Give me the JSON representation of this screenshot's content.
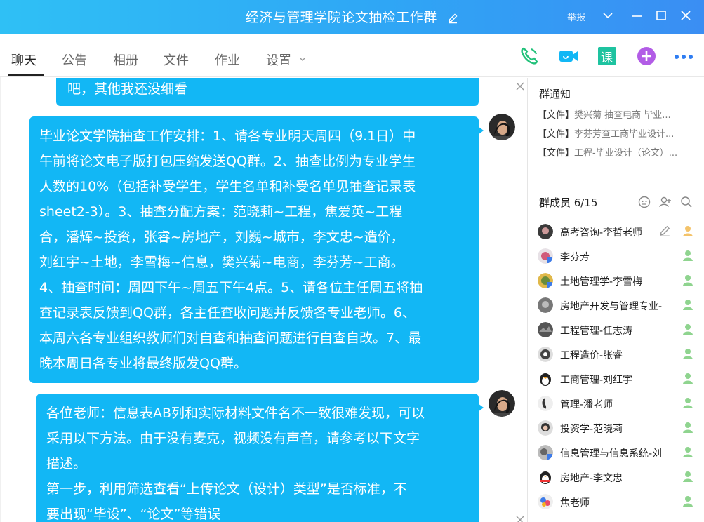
{
  "window": {
    "title": "经济与管理学院论文抽检工作群",
    "report_label": "举报"
  },
  "tabs": [
    {
      "label": "聊天",
      "active": true
    },
    {
      "label": "公告"
    },
    {
      "label": "相册"
    },
    {
      "label": "文件"
    },
    {
      "label": "作业"
    },
    {
      "label": "设置"
    }
  ],
  "toolbar": {
    "icons": [
      "phone-icon",
      "video-icon",
      "course-icon",
      "add-app-icon",
      "more-icon"
    ],
    "course_label": "课",
    "colors": {
      "phone": "#22c17a",
      "video": "#12b7f5",
      "course": "#1ec3a0",
      "add": "#b25ce6",
      "more": "#2f7df2"
    }
  },
  "chat": {
    "messages": [
      {
        "lines": [
          "吧，其他我还没细看"
        ]
      },
      {
        "lines": [
          "毕业论文学院抽查工作安排：1、请各专业明天周四（9.1日）中",
          "午前将论文电子版打包压缩发送QQ群。2、抽查比例为专业学生",
          "人数的10%（包括补受学生，学生名单和补受名单见抽查记录表",
          "sheet2-3）。3、抽查分配方案：范晓莉~工程，焦爱英~工程",
          "合，潘辉~投资，张睿~房地产，刘巍~城市，李文忠~造价，",
          "刘红宇~土地，李雪梅~信息，樊兴菊~电商，李芬芳~工商。",
          "4、抽查时间：周四下午~周五下午4点。5、请各位主任周五将抽",
          "查记录表反馈到QQ群，各主任查收问题并反馈各专业老师。6、",
          "本周六各专业组织教师们对自查和抽查问题进行自查自改。7、最",
          "晚本周日各专业将最终版发QQ群。"
        ]
      },
      {
        "lines": [
          "各位老师：信息表AB列和实际材料文件名不一致很难发现，可以",
          "采用以下方法。由于没有麦克，视频没有声音，请参考以下文字",
          "描述。",
          "第一步，利用筛选查看“上传论文（设计）类型”是否标准，不",
          "要出现“毕设”、“论文”等错误"
        ]
      }
    ],
    "bubble_color": "#12b7f5"
  },
  "side": {
    "notice": {
      "title": "群通知",
      "items": [
        {
          "tag": "【文件】",
          "text": "樊兴菊  抽查电商 毕业..."
        },
        {
          "tag": "【文件】",
          "text": "李芬芳查工商毕业设计..."
        },
        {
          "tag": "【文件】",
          "text": "工程-毕业设计（论文）..."
        }
      ]
    },
    "members": {
      "title": "群成员 6/15",
      "list": [
        {
          "name": "高考咨询-李哲老师"
        },
        {
          "name": "李芬芳"
        },
        {
          "name": "土地管理学-李雪梅"
        },
        {
          "name": "房地产开发与管理专业-"
        },
        {
          "name": "工程管理-任志涛"
        },
        {
          "name": "工程造价-张睿"
        },
        {
          "name": "工商管理-刘红宇"
        },
        {
          "name": "管理-潘老师"
        },
        {
          "name": "投资学-范晓莉"
        },
        {
          "name": "信息管理与信息系统-刘"
        },
        {
          "name": "房地产-李文忠"
        },
        {
          "name": "焦老师"
        }
      ]
    }
  }
}
